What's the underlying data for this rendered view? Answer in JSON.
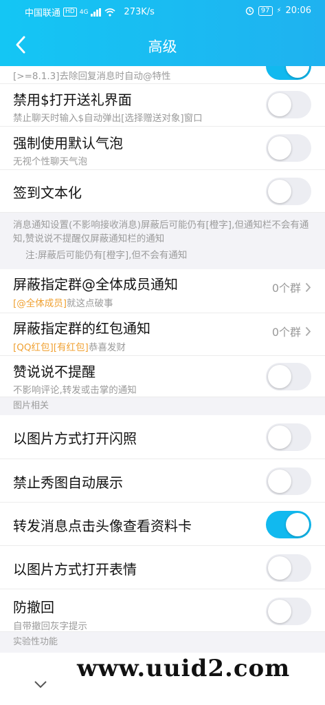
{
  "status": {
    "carrier": "中国联通",
    "hd": "HD",
    "network": "4G",
    "speed": "273K/s",
    "battery": "97",
    "time": "20:06"
  },
  "nav": {
    "title": "高级"
  },
  "partial_top": {
    "sub": "[>=8.1.3]去除回复消息时自动@特性",
    "on": true
  },
  "items": [
    {
      "label": "禁用$打开送礼界面",
      "sub": "禁止聊天时输入$自动弹出[选择赠送对象]窗口",
      "on": false
    },
    {
      "label": "强制使用默认气泡",
      "sub": "无视个性聊天气泡",
      "on": false
    },
    {
      "label": "签到文本化",
      "on": false
    }
  ],
  "notice": {
    "text": "消息通知设置(不影响接收消息)屏蔽后可能仍有[橙字],但通知栏不会有通知,赞说说不提醒仅屏蔽通知栏的通知",
    "note": "注:屏蔽后可能仍有[橙字],但不会有通知"
  },
  "group_items": [
    {
      "label": "屏蔽指定群@全体成员通知",
      "sub_hl": "[@全体成员]",
      "sub_rest": "就这点破事",
      "value": "0个群"
    },
    {
      "label": "屏蔽指定群的红包通知",
      "sub_hl": "[QQ红包][有红包]",
      "sub_rest": "恭喜发财",
      "value": "0个群"
    }
  ],
  "like_item": {
    "label": "赞说说不提醒",
    "sub": "不影响评论,转发或击掌的通知",
    "on": false
  },
  "section_image": "图片相关",
  "image_items": [
    {
      "label": "以图片方式打开闪照",
      "on": false
    },
    {
      "label": "禁止秀图自动展示",
      "on": false
    },
    {
      "label": "转发消息点击头像查看资料卡",
      "on": true
    },
    {
      "label": "以图片方式打开表情",
      "on": false
    }
  ],
  "anti_recall": {
    "label": "防撤回",
    "sub": "自带撤回灰字提示",
    "on": false
  },
  "section_experimental": "实验性功能",
  "watermark": "www.uuid2.com"
}
